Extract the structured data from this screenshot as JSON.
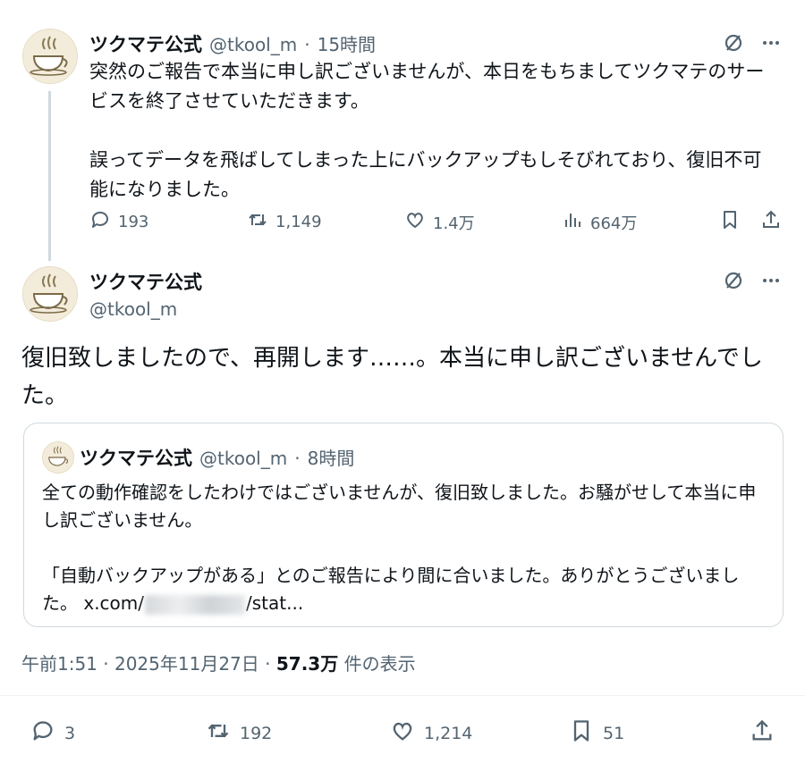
{
  "tweet1": {
    "display_name": "ツクマテ公式",
    "handle": "@tkool_m",
    "separator": "·",
    "time": "15時間",
    "text": "突然のご報告で本当に申し訳ございませんが、本日をもちましてツクマテのサービスを終了させていただきます。\n\n誤ってデータを飛ばしてしまった上にバックアップもしそびれており、復旧不可能になりました。",
    "replies": "193",
    "retweets": "1,149",
    "likes": "1.4万",
    "views": "664万",
    "icons": [
      "grok-icon",
      "more-icon",
      "reply-icon",
      "retweet-icon",
      "like-icon",
      "views-icon",
      "bookmark-icon",
      "share-icon"
    ]
  },
  "tweet2": {
    "display_name": "ツクマテ公式",
    "handle": "@tkool_m",
    "text": "復旧致しましたので、再開します……。本当に申し訳ございませんでした。",
    "quote": {
      "display_name": "ツクマテ公式",
      "handle": "@tkool_m",
      "separator": "·",
      "time": "8時間",
      "text_line1": "全ての動作確認をしたわけではございませんが、復旧致しました。お騒がせして本当に申し訳ございません。\n\n「自動バックアップがある」とのご報告により間に合いました。ありがとうございました。 ",
      "link_prefix": "x.com/",
      "link_suffix": "/stat..."
    },
    "timestamp": "午前1:51 · 2025年11月27日 · ",
    "view_count": "57.3万",
    "view_label": " 件の表示",
    "replies": "3",
    "retweets": "192",
    "likes": "1,214",
    "bookmarks": "51"
  }
}
